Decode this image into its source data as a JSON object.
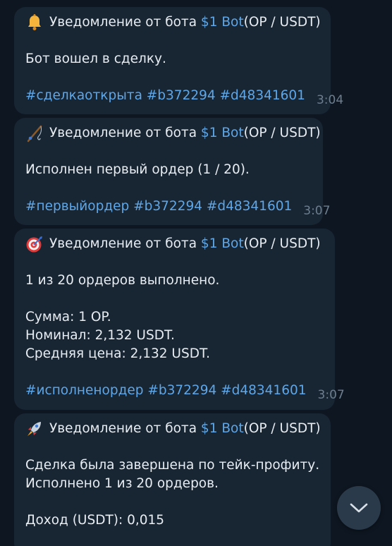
{
  "messages": [
    {
      "emoji": "bell-icon",
      "header": {
        "prefix": "Уведомление от бота ",
        "bot": "$1 Bot",
        "pair": " (OP / USDT)"
      },
      "lines": [
        "Бот вошел в сделку."
      ],
      "tags": "#сделкаоткрыта #b372294 #d48341601",
      "time": "3:04"
    },
    {
      "emoji": "fishing-rod-icon",
      "header": {
        "prefix": "Уведомление от бота ",
        "bot": "$1 Bot",
        "pair": " (OP / USDT)"
      },
      "lines": [
        "Исполнен первый ордер (1 / 20)."
      ],
      "tags": "#первыйордер #b372294 #d48341601",
      "time": "3:07"
    },
    {
      "emoji": "target-icon",
      "header": {
        "prefix": "Уведомление от бота ",
        "bot": "$1 Bot",
        "pair": " (OP / USDT)"
      },
      "lines": [
        "1 из 20 ордеров выполнено.",
        "",
        "Сумма: 1 OP.",
        "Номинал: 2,132 USDT.",
        "Средняя цена: 2,132 USDT."
      ],
      "tags": "#исполненордер #b372294 #d48341601",
      "time": "3:07"
    },
    {
      "emoji": "rocket-icon",
      "header": {
        "prefix": "Уведомление от бота ",
        "bot": "$1 Bot",
        "pair": " (OP / USDT)"
      },
      "lines": [
        "Сделка была завершена по тейк-профиту.",
        "Исполнено 1 из 20 ордеров.",
        "",
        "Доход (USDT): 0,015"
      ]
    }
  ],
  "scroll_button": {
    "icon": "chevron-down-icon"
  },
  "colors": {
    "background": "#0e1621",
    "bubble": "#182533",
    "link": "#5ea7e8",
    "text": "#e8edf2",
    "time": "#6d7f8f"
  }
}
